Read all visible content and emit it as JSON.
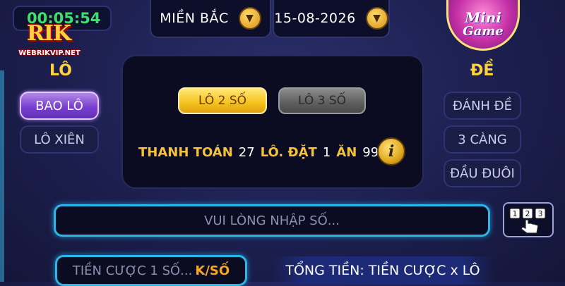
{
  "timer": "00:05:54",
  "logo": {
    "brand": "RIK",
    "url": "WEBRIKVIP.NET"
  },
  "header": {
    "region": "MIỀN BẮC",
    "date": "15-08-2026",
    "mini_game_line1": "Mini",
    "mini_game_line2": "Game"
  },
  "left": {
    "title": "LÔ",
    "buttons": [
      "BAO LÔ",
      "LÔ XIÊN"
    ],
    "active": "BAO LÔ"
  },
  "right": {
    "title": "ĐỀ",
    "buttons": [
      "ĐÁNH ĐỀ",
      "3 CÀNG",
      "ĐẦU ĐUÔI"
    ]
  },
  "panel": {
    "tabs": [
      "LÔ 2 SỐ",
      "LÔ 3 SỐ"
    ],
    "active_tab": "LÔ 2 SỐ",
    "pay_label": "THANH TOÁN",
    "pay_value": "27",
    "bet_label": "LÔ. ĐẶT",
    "bet_value": "1",
    "win_label": "ĂN",
    "win_value": "99",
    "info_glyph": "i"
  },
  "input": {
    "placeholder": "VUI LÒNG NHẬP SỐ..."
  },
  "bottom": {
    "bet_placeholder": "TIỀN CƯỢC 1 SỐ...",
    "bet_unit": "K/SỐ",
    "total_text": "TỔNG TIỀN: TIỀN CƯỢC x LÔ"
  },
  "colors": {
    "gold": "#f4c23a",
    "accent_blue": "#2fb4e6",
    "active_purple": "#7a3fd0",
    "timer_green": "#3ee06a"
  },
  "icons": {
    "region_dropdown": "chevron-down-icon",
    "date_dropdown": "chevron-down-icon",
    "info": "info-icon",
    "keypad": "keypad-hand-icon"
  }
}
